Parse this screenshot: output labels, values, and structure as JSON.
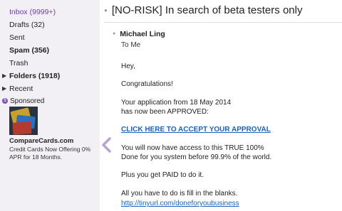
{
  "sidebar": {
    "folders": [
      {
        "label": "Inbox (9999+)",
        "bold": false,
        "active": true,
        "caret": false
      },
      {
        "label": "Drafts (32)",
        "bold": false,
        "active": false,
        "caret": false
      },
      {
        "label": "Sent",
        "bold": false,
        "active": false,
        "caret": false
      },
      {
        "label": "Spam (356)",
        "bold": true,
        "active": false,
        "caret": false
      },
      {
        "label": "Trash",
        "bold": false,
        "active": false,
        "caret": false
      },
      {
        "label": "Folders (1918)",
        "bold": true,
        "active": false,
        "caret": true
      },
      {
        "label": "Recent",
        "bold": false,
        "active": false,
        "caret": true
      }
    ],
    "sponsored_label": "Sponsored",
    "ad": {
      "title": "CompareCards.com",
      "text": "Credit Cards Now Offering 0% APR for 18 Months."
    }
  },
  "message": {
    "subject": "[NO-RISK] In search of beta testers only",
    "sender": "Michael Ling",
    "to": "To  Me",
    "lines": {
      "greeting": "Hey,",
      "congrats": "Congratulations!",
      "app1": "Your application from 18 May 2014",
      "app2": "has now been APPROVED:",
      "cta": "CLICK HERE TO ACCEPT YOUR APPROVAL",
      "access1": "You will now have access to this TRUE 100%",
      "access2": "Done for you system before 99.9% of the world.",
      "paid": "Plus you get PAID to do it.",
      "fill": "All you have to do is fill in the blanks.",
      "url": "http://tinyurl.com/doneforyoubusiness"
    }
  },
  "colors": {
    "accent": "#6b3fa0",
    "link": "#1a62b8",
    "sidebar_bg": "#f2f0f5"
  }
}
